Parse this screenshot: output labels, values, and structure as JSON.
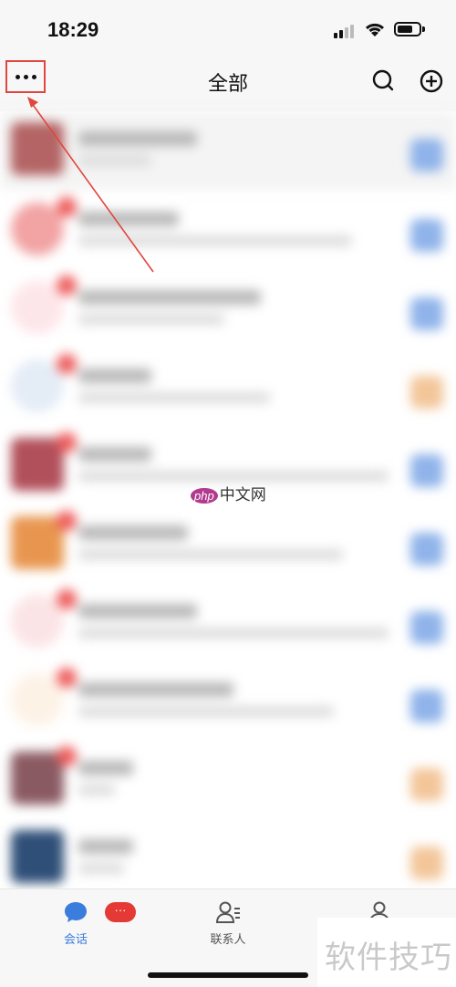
{
  "status_bar": {
    "time": "18:29"
  },
  "nav": {
    "title": "全部",
    "more_icon": "more-dots-icon",
    "search_icon": "search-icon",
    "add_icon": "plus-circle-icon"
  },
  "watermark": {
    "php": "php",
    "text": "中文网"
  },
  "tabs": [
    {
      "label": "会话",
      "icon": "chat-bubble-icon",
      "active": true,
      "badge": "···"
    },
    {
      "label": "联系人",
      "icon": "contacts-icon",
      "active": false
    },
    {
      "label": "",
      "icon": "profile-icon",
      "active": false
    }
  ],
  "corner_watermark": "软件技巧",
  "colors": {
    "accent": "#3b7ddd",
    "badge": "#e53935",
    "annotation": "#e0463d"
  }
}
